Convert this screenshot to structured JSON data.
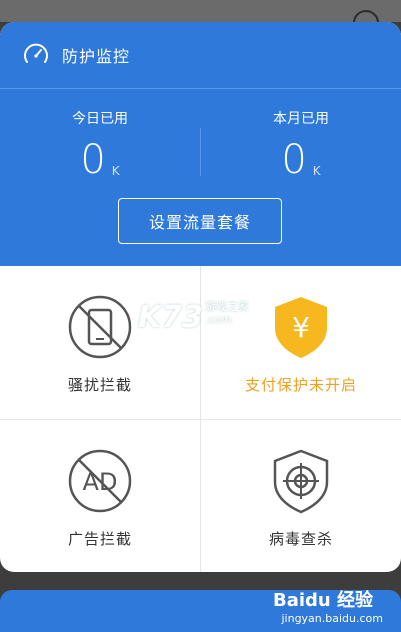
{
  "header": {
    "title": "防护监控",
    "today_label": "今日已用",
    "today_value": "0",
    "today_unit": "K",
    "month_label": "本月已用",
    "month_value": "0",
    "month_unit": "K",
    "plan_button_label": "设置流量套餐"
  },
  "features": [
    {
      "label": "骚扰拦截",
      "icon": "no-phone-icon"
    },
    {
      "label": "支付保护未开启",
      "icon": "yuan-shield-icon"
    },
    {
      "label": "广告拦截",
      "icon": "no-ad-icon"
    },
    {
      "label": "病毒查杀",
      "icon": "virus-scan-icon"
    }
  ],
  "icons": {
    "ad_text": "AD",
    "yuan_symbol": "¥"
  },
  "watermarks": {
    "k73": "K73",
    "k73_sub_line1": "游戏之家",
    "k73_sub_line2": ".com",
    "baidu": "Baidu 经验",
    "baidu_sub": "jingyan.baidu.com"
  },
  "colors": {
    "header_blue": "#2f79da",
    "warning_orange": "#f0a020",
    "shield_yellow": "#f6b81e",
    "icon_gray": "#555555"
  }
}
